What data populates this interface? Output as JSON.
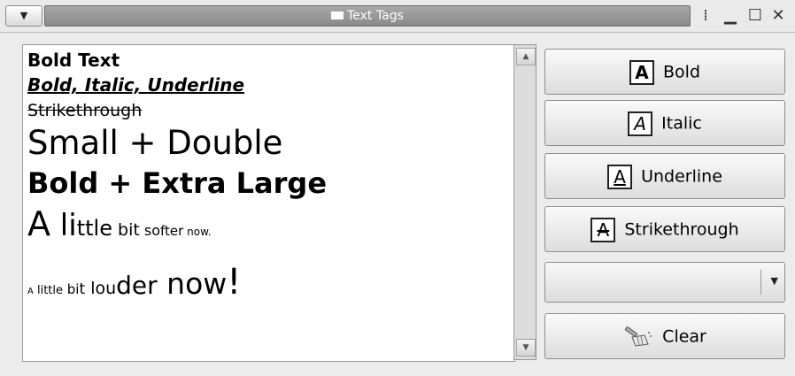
{
  "window": {
    "title": "Text Tags",
    "menu_icon": "window-menu-icon",
    "controls": [
      "minimize-icon",
      "maximize-icon",
      "close-icon"
    ]
  },
  "text_view": {
    "lines": {
      "bold": "Bold Text",
      "bold_italic_underline": "Bold, Italic, Underline",
      "strike": "Strikethrough",
      "small_double": "Small + Double",
      "bold_xl": "Bold + Extra Large",
      "softer": [
        {
          "t": "A",
          "size": 38
        },
        {
          "t": " li",
          "size": 34
        },
        {
          "t": "ttle",
          "size": 24
        },
        {
          "t": " bit",
          "size": 19
        },
        {
          "t": " so",
          "size": 16
        },
        {
          "t": "fter",
          "size": 15
        },
        {
          "t": " now.",
          "size": 12
        }
      ],
      "louder": [
        {
          "t": "A",
          "size": 10
        },
        {
          "t": " little",
          "size": 13
        },
        {
          "t": " bi",
          "size": 15
        },
        {
          "t": "t",
          "size": 17
        },
        {
          "t": " lou",
          "size": 19
        },
        {
          "t": "der",
          "size": 28
        },
        {
          "t": " now",
          "size": 33
        },
        {
          "t": "!",
          "size": 40
        }
      ]
    }
  },
  "buttons": {
    "bold": {
      "glyph": "A",
      "label": "Bold"
    },
    "italic": {
      "glyph": "A",
      "label": "Italic"
    },
    "underline": {
      "glyph": "A",
      "label": "Underline"
    },
    "strike": {
      "glyph": "A",
      "label": "Strikethrough"
    },
    "clear": {
      "label": "Clear",
      "icon": "broom-icon"
    }
  },
  "combo": {
    "value": ""
  }
}
